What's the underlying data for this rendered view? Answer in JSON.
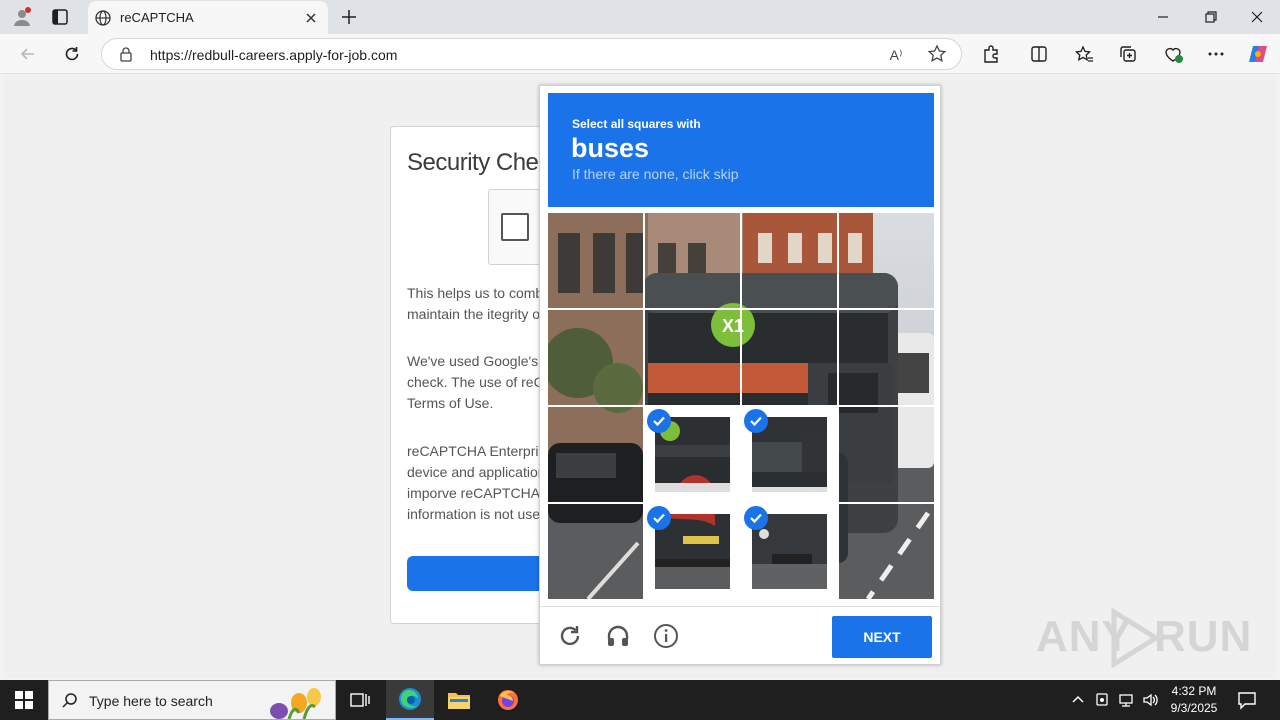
{
  "browser": {
    "tab_title": "reCAPTCHA",
    "url": "https://redbull-careers.apply-for-job.com",
    "read_aloud_glyph": "A⁾"
  },
  "security_page": {
    "title": "Security Check",
    "paragraph1": [
      "This helps us to combat",
      "maintain the itegrity of"
    ],
    "paragraph2": [
      "We've used Google's r",
      "check. The use of reCA",
      "Terms of Use."
    ],
    "paragraph3": [
      "reCAPTCHA Enterpris",
      "device and application",
      "imporve reCAPTCHA I",
      "information is not used"
    ]
  },
  "challenge": {
    "instruction": "Select all squares with",
    "object": "buses",
    "skip_hint": "If there are none, click skip",
    "selected_tiles": [
      [
        2,
        1
      ],
      [
        2,
        2
      ],
      [
        3,
        1
      ],
      [
        3,
        2
      ]
    ],
    "next_label": "NEXT",
    "accent_color": "#1a73e8"
  },
  "watermark": {
    "left": "ANY",
    "right": "RUN"
  },
  "taskbar": {
    "search_placeholder": "Type here to search",
    "time": "4:32 PM",
    "date": "9/3/2025"
  }
}
